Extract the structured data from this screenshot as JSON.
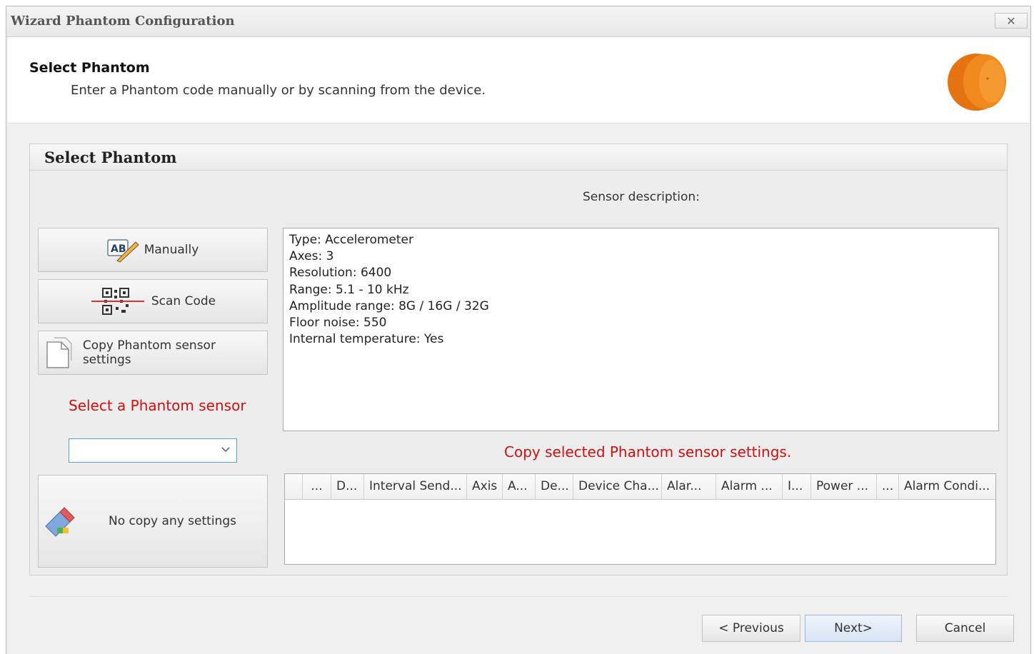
{
  "window": {
    "title": "Wizard Phantom Configuration",
    "close_label": "✕"
  },
  "header": {
    "title": "Select Phantom",
    "subtitle": "Enter a Phantom code manually or by scanning from the device."
  },
  "group": {
    "title": "Select Phantom"
  },
  "buttons": {
    "manually": "Manually",
    "scan_code": "Scan Code",
    "copy_settings": "Copy Phantom sensor settings",
    "no_copy": "No copy any settings"
  },
  "select_sensor": {
    "label": "Select a Phantom sensor",
    "value": ""
  },
  "description": {
    "label": "Sensor description:",
    "lines": [
      "Type: Accelerometer",
      "Axes: 3",
      "Resolution: 6400",
      "Range: 5.1 - 10 kHz",
      "Amplitude range: 8G / 16G / 32G",
      "Floor noise: 550",
      "Internal temperature: Yes"
    ]
  },
  "copy_label": "Copy selected Phantom sensor settings.",
  "grid": {
    "columns": [
      "",
      "...",
      "D...",
      "Interval Send...",
      "Axis",
      "A...",
      "De...",
      "Device Cha...",
      "Alar...",
      "Alarm ...",
      "I...",
      "Power ...",
      "...",
      "Alarm Condi..."
    ]
  },
  "nav": {
    "previous": "< Previous",
    "next": "Next>",
    "cancel": "Cancel"
  },
  "colors": {
    "accent_red": "#d01010",
    "logo_orange": "#ee7d16",
    "focus_blue": "#5aa0d8"
  },
  "icons": {
    "manually": "ab-pencil-icon",
    "scan": "qr-code-icon",
    "copy": "document-icon",
    "no_copy": "eraser-icon",
    "combo": "chevron-down-icon",
    "logo": "phantom-sensor-logo"
  }
}
